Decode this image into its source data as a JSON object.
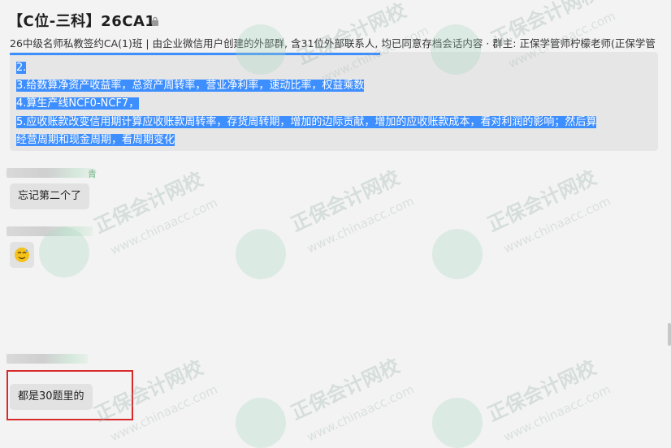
{
  "header": {
    "title": "【C位-三科】26CA1",
    "subtitle": "26中级名师私教签约CA(1)班 | 由企业微信用户创建的外部群, 含31位外部联系人, 均已同意存档会话内容 · 群主: 正保学管师柠檬老师(正保学管"
  },
  "quote": {
    "lines": [
      "2.",
      "3.给数算净资产收益率，总资产周转率，营业净利率，速动比率，权益乘数",
      "4.算生产线NCF0-NCF7，",
      "5.应收账款改变信用期计算应收账款周转率，存货周转期，增加的边际贡献，增加的应收账款成本，看对利润的影响；然后算",
      "经营周期和现金周期，看周期变化"
    ]
  },
  "messages": [
    {
      "sender_tail": "青",
      "text": "忘记第二个了"
    },
    {
      "sender_tail": "",
      "text": ""
    },
    {
      "sender_tail": "",
      "text": "都是30题里的"
    }
  ],
  "watermark": {
    "text": "正保会计网校",
    "url": "www.chinaacc.com"
  },
  "colors": {
    "selection": "#3d8eff",
    "highlight_box": "#d82a2a",
    "background": "#f3f3f3"
  },
  "icons": [
    "lock-icon",
    "emoji-sweat-icon"
  ]
}
